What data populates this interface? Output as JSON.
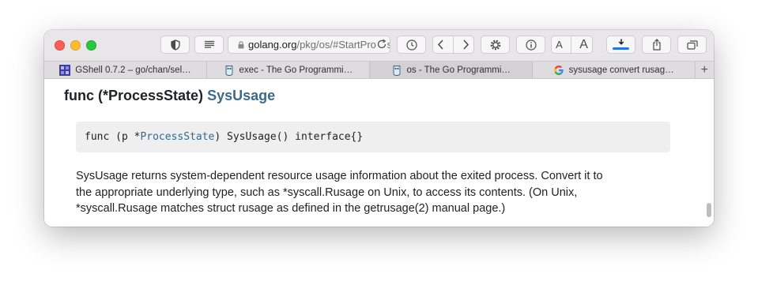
{
  "address_bar": {
    "host": "golang.org",
    "path": "/pkg/os/#StartProces"
  },
  "tabs": [
    {
      "title": "GShell 0.7.2 – go/chan/sel…",
      "favicon": "gshell-favicon"
    },
    {
      "title": "exec - The Go Programmi…",
      "favicon": "gopher-favicon"
    },
    {
      "title": "os - The Go Programmi…",
      "favicon": "gopher-favicon",
      "active": true
    },
    {
      "title": "sysusage convert rusag…",
      "favicon": "google-favicon"
    }
  ],
  "toolbar": {
    "font_smaller_label": "A",
    "font_larger_label": "A",
    "new_tab_label": "+"
  },
  "page": {
    "heading_prefix": "func (*ProcessState) ",
    "heading_link": "SysUsage",
    "code_prefix": "func (p *",
    "code_type_link": "ProcessState",
    "code_suffix": ") SysUsage() interface{}",
    "description_line1": "SysUsage returns system-dependent resource usage information about the exited process. Convert it to",
    "description_line2": "the appropriate underlying type, such as *syscall.Rusage on Unix, to access its contents. (On Unix,",
    "description_line3": "*syscall.Rusage matches struct rusage as defined in the getrusage(2) manual page.)"
  },
  "colors": {
    "link": "#3c6a8c",
    "download_progress": "#1f74e8",
    "close": "#fe5f57",
    "minimize": "#febc2e",
    "zoom": "#28c840"
  }
}
